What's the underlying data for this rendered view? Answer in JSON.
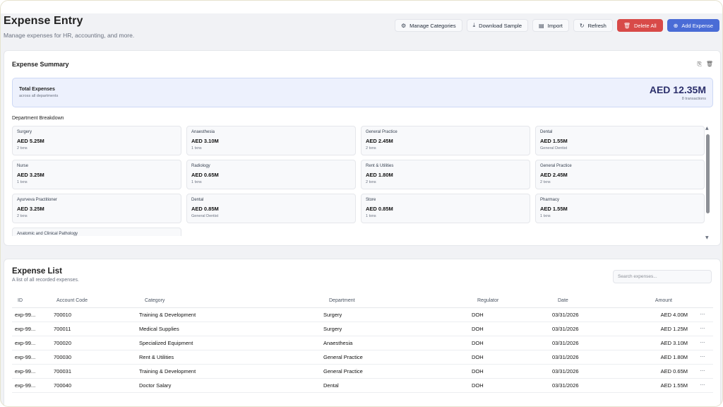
{
  "header": {
    "title": "Expense Entry",
    "subtitle": "Manage expenses for HR, accounting, and more."
  },
  "toolbar": {
    "manage_categories": "Manage Categories",
    "download_sample": "Download Sample",
    "import": "Import",
    "refresh": "Refresh",
    "delete_all": "Delete All",
    "add_expense": "Add Expense"
  },
  "colors": {
    "danger": "#d84a48",
    "primary": "#4a6cd6",
    "total_bg": "#edf1fd"
  },
  "summary": {
    "title": "Expense Summary",
    "total_label": "Total Expenses",
    "total_sub": "across all departments",
    "total_amount": "AED 12.35M",
    "total_count": "8 transactions",
    "breakdown_label": "Department Breakdown",
    "departments": [
      {
        "name": "Surgery",
        "amount": "AED 5.25M",
        "sub": "2 txns"
      },
      {
        "name": "Anaesthesia",
        "amount": "AED 3.10M",
        "sub": "1 txns"
      },
      {
        "name": "General Practice",
        "amount": "AED 2.45M",
        "sub": "2 txns"
      },
      {
        "name": "Dental",
        "amount": "AED 1.55M",
        "sub": "General Dentist"
      },
      {
        "name": "Nurse",
        "amount": "AED 3.25M",
        "sub": "1 txns"
      },
      {
        "name": "Radiology",
        "amount": "AED 0.65M",
        "sub": "1 txns"
      },
      {
        "name": "Rent & Utilities",
        "amount": "AED 1.80M",
        "sub": "2 txns"
      },
      {
        "name": "General Practice",
        "amount": "AED 2.45M",
        "sub": "2 txns"
      },
      {
        "name": "Ayurveva Practitioner",
        "amount": "AED 3.25M",
        "sub": "2 txns"
      },
      {
        "name": "Dental",
        "amount": "AED 0.85M",
        "sub": "General Dentist"
      },
      {
        "name": "Store",
        "amount": "AED 0.85M",
        "sub": "1 txns"
      },
      {
        "name": "Pharmacy",
        "amount": "AED 1.55M",
        "sub": "1 txns"
      },
      {
        "name": "Anatomic and Clinical Pathology",
        "amount": "",
        "sub": ""
      }
    ]
  },
  "list": {
    "title": "Expense List",
    "subtitle": "A list of all recorded expenses.",
    "search_placeholder": "Search expenses...",
    "columns": [
      "ID",
      "Account Code",
      "Category",
      "Department",
      "Regulator",
      "Date",
      "Amount"
    ],
    "rows": [
      {
        "id": "exp-99...",
        "code": "700010",
        "category": "Training & Development",
        "department": "Surgery",
        "regulator": "DOH",
        "date": "03/31/2026",
        "amount": "AED 4.00M"
      },
      {
        "id": "exp-99...",
        "code": "700011",
        "category": "Medical Supplies",
        "department": "Surgery",
        "regulator": "DOH",
        "date": "03/31/2026",
        "amount": "AED 1.25M"
      },
      {
        "id": "exp-99...",
        "code": "700020",
        "category": "Specialized Equipment",
        "department": "Anaesthesia",
        "regulator": "DOH",
        "date": "03/31/2026",
        "amount": "AED 3.10M"
      },
      {
        "id": "exp-99...",
        "code": "700030",
        "category": "Rent & Utilities",
        "department": "General Practice",
        "regulator": "DOH",
        "date": "03/31/2026",
        "amount": "AED 1.80M"
      },
      {
        "id": "exp-99...",
        "code": "700031",
        "category": "Training & Development",
        "department": "General Practice",
        "regulator": "DOH",
        "date": "03/31/2026",
        "amount": "AED 0.65M"
      },
      {
        "id": "exp-99...",
        "code": "700040",
        "category": "Doctor Salary",
        "department": "Dental",
        "regulator": "DOH",
        "date": "03/31/2026",
        "amount": "AED 1.55M"
      }
    ],
    "row_action": "···"
  }
}
